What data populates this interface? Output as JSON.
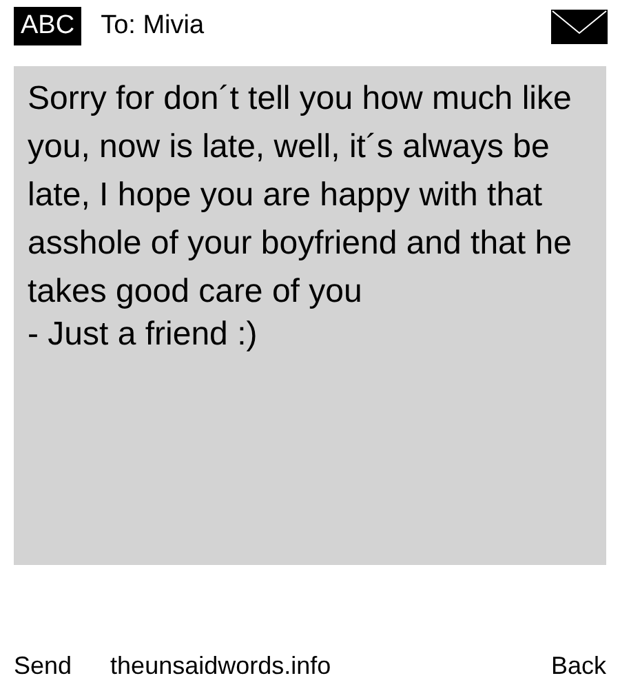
{
  "header": {
    "input_mode": "ABC",
    "recipient": "To: Mivia"
  },
  "message": {
    "body": "Sorry for don´t tell you how much like you, now is late, well, it´s always be late, I hope you are happy with that asshole of your boyfriend and that he takes good care of you",
    "signature": "- Just a friend :)"
  },
  "softkeys": {
    "left": "Send",
    "center": "theunsaidwords.info",
    "right": "Back"
  }
}
